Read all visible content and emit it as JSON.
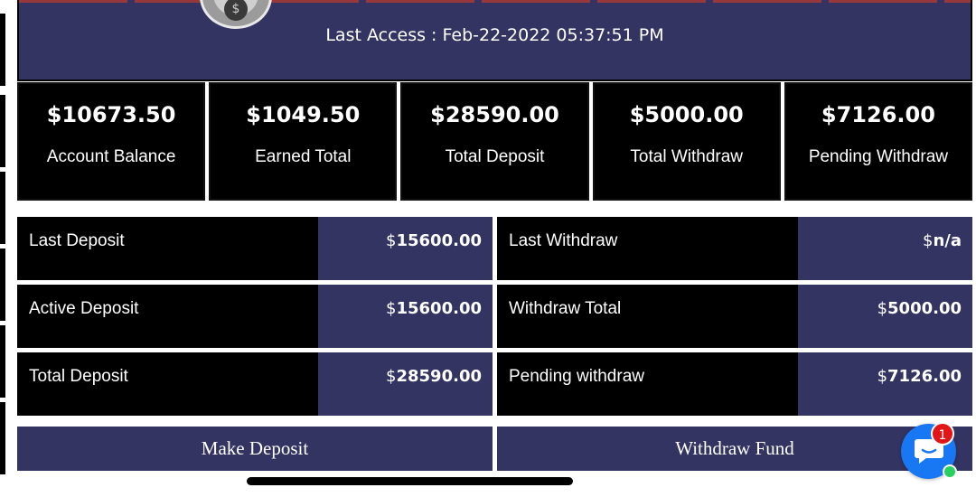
{
  "header": {
    "last_access": "Last Access : Feb-22-2022 05:37:51 PM",
    "avatar_icon": "money-bag-icon"
  },
  "stats": [
    {
      "amount": "$10673.50",
      "label": "Account Balance"
    },
    {
      "amount": "$1049.50",
      "label": "Earned Total"
    },
    {
      "amount": "$28590.00",
      "label": "Total Deposit"
    },
    {
      "amount": "$5000.00",
      "label": "Total Withdraw"
    },
    {
      "amount": "$7126.00",
      "label": "Pending Withdraw"
    }
  ],
  "details": {
    "last_deposit": {
      "label": "Last Deposit",
      "currency": "$",
      "value": "15600.00"
    },
    "last_withdraw": {
      "label": "Last Withdraw",
      "currency": "$",
      "value": "n/a"
    },
    "active_deposit": {
      "label": "Active Deposit",
      "currency": "$",
      "value": "15600.00"
    },
    "withdraw_total": {
      "label": "Withdraw Total",
      "currency": "$",
      "value": "5000.00"
    },
    "total_deposit": {
      "label": "Total Deposit",
      "currency": "$",
      "value": "28590.00"
    },
    "pending_withdraw": {
      "label": "Pending withdraw",
      "currency": "$",
      "value": "7126.00"
    }
  },
  "actions": {
    "make_deposit": "Make Deposit",
    "withdraw_fund": "Withdraw Fund"
  },
  "chat": {
    "icon": "chat-bubble-icon",
    "unread_count": "1"
  },
  "colors": {
    "primary": "#343463",
    "panel": "#000000",
    "chat": "#1877f2",
    "badge": "#e21616",
    "online": "#27d05f"
  }
}
